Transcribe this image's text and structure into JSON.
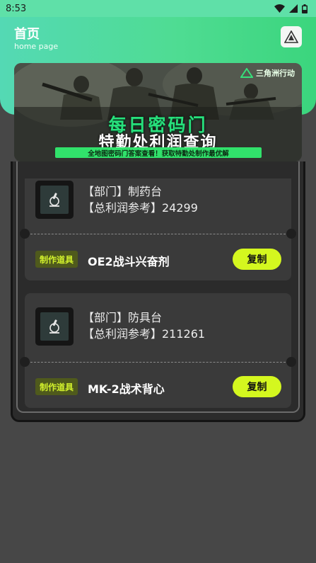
{
  "status_bar": {
    "time": "8:53"
  },
  "header": {
    "title": "首页",
    "subtitle": "home page",
    "app_icon": "triangle-logo-icon"
  },
  "banner": {
    "logo_text": "三角洲行动",
    "title_line1": "每日密码门",
    "title_line2": "特勤处利润查询",
    "strip_text": "全地图密码门答案查看！获取特勤处制作最优解"
  },
  "cards": [
    {
      "dept": "【部门】制药台",
      "profit": "【总利润参考】24299",
      "tag": "制作道具",
      "item_name": "OE2战斗兴奋剂",
      "copy_label": "复制",
      "icon": "microscope-icon"
    },
    {
      "dept": "【部门】防具台",
      "profit": "【总利润参考】211261",
      "tag": "制作道具",
      "item_name": "MK-2战术背心",
      "copy_label": "复制",
      "icon": "microscope-icon"
    }
  ],
  "colors": {
    "accent": "#d4f71f",
    "header_green": "#4fdc93",
    "background": "#474747",
    "card": "#3a3a3a"
  }
}
